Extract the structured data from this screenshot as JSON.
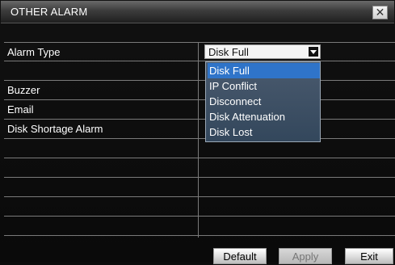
{
  "window": {
    "title": "OTHER ALARM",
    "close_symbol": "✕"
  },
  "form": {
    "rows": [
      {
        "label": "Alarm Type"
      },
      {
        "label": ""
      },
      {
        "label": "Buzzer"
      },
      {
        "label": "Email"
      },
      {
        "label": "Disk Shortage Alarm"
      },
      {
        "label": ""
      },
      {
        "label": ""
      },
      {
        "label": ""
      },
      {
        "label": ""
      },
      {
        "label": ""
      }
    ],
    "alarm_type": {
      "selected": "Disk Full",
      "options": [
        "Disk Full",
        "IP Conflict",
        "Disconnect",
        "Disk Attenuation",
        "Disk Lost"
      ]
    }
  },
  "buttons": {
    "default": "Default",
    "apply": "Apply",
    "exit": "Exit"
  },
  "colors": {
    "highlight": "#2f74c9",
    "background": "#0c0c0c",
    "grid_line": "#7a7a7a"
  }
}
